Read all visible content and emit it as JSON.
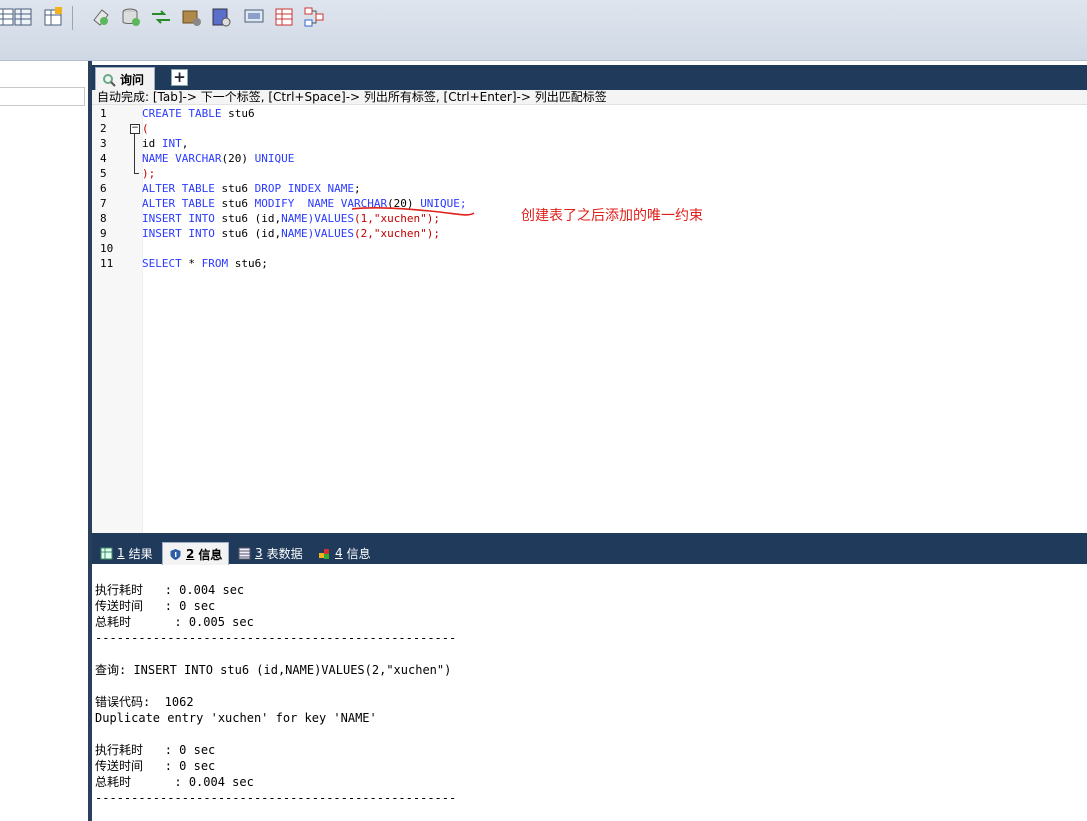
{
  "toolbar": {
    "icons": [
      "table-grid-icon",
      "table-edit-icon",
      "eraser-icon",
      "database-icon",
      "sync-icon",
      "backup-icon",
      "schema-icon",
      "report-icon",
      "import-icon",
      "designer-icon"
    ]
  },
  "query_tab": {
    "label": "询问",
    "add_label": "+"
  },
  "autocomplete_hint": "自动完成: [Tab]-> 下一个标签, [Ctrl+Space]-> 列出所有标签, [Ctrl+Enter]-> 列出匹配标签",
  "editor": {
    "line_numbers": [
      "1",
      "2",
      "3",
      "4",
      "5",
      "6",
      "7",
      "8",
      "9",
      "10",
      "11"
    ]
  },
  "annotation": "创建表了之后添加的唯一约束",
  "result_tabs": [
    {
      "num": "1",
      "label": "结果"
    },
    {
      "num": "2",
      "label": "信息"
    },
    {
      "num": "3",
      "label": "表数据"
    },
    {
      "num": "4",
      "label": "信息"
    }
  ],
  "messages": {
    "exec1_label": "执行耗时",
    "exec1_value": "   : 0.004 sec",
    "send1_label": "传送时间",
    "send1_value": "   : 0 sec",
    "total1_label": "总耗时",
    "total1_value": "      : 0.005 sec",
    "sep1": "--------------------------------------------------",
    "query_label": "查询:",
    "query_text": " INSERT INTO stu6 (id,NAME)VALUES(2,\"xuchen\")",
    "err_label": "错误代码:",
    "err_code": "  1062",
    "err_msg": "Duplicate entry 'xuchen' for key 'NAME'",
    "exec2_label": "执行耗时",
    "exec2_value": "   : 0 sec",
    "send2_label": "传送时间",
    "send2_value": "   : 0 sec",
    "total2_label": "总耗时",
    "total2_value": "      : 0.004 sec",
    "sep2": "--------------------------------------------------"
  },
  "colors": {
    "keyword": "#2a3aff",
    "string": "#c00000",
    "annotation": "#e0211b",
    "frame": "#1f3a5b"
  }
}
